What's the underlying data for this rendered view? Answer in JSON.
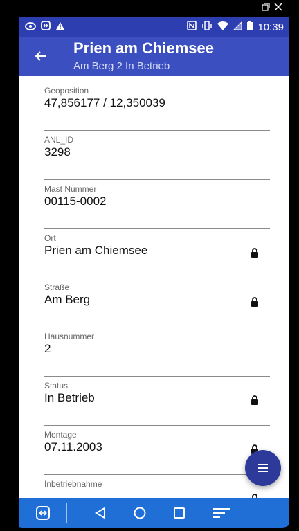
{
  "appbar": {
    "title": "Prien am Chiemsee",
    "subtitle": "Am Berg 2 In Betrieb"
  },
  "statusbar": {
    "time": "10:39",
    "icons_left": [
      "eye-icon",
      "teamviewer-icon",
      "warning-icon"
    ],
    "icons_right": [
      "nfc-icon",
      "vibrate-icon",
      "wifi-icon",
      "signal-icon",
      "battery-icon"
    ]
  },
  "window_controls": [
    "restore-icon",
    "close-icon"
  ],
  "fields": [
    {
      "label": "Geoposition",
      "value": "47,856177 / 12,350039",
      "locked": false
    },
    {
      "label": "ANL_ID",
      "value": "3298",
      "locked": false
    },
    {
      "label": "Mast Nummer",
      "value": "00115-0002",
      "locked": false
    },
    {
      "label": "Ort",
      "value": "Prien am Chiemsee",
      "locked": true
    },
    {
      "label": "Straße",
      "value": "Am Berg",
      "locked": true
    },
    {
      "label": "Hausnummer",
      "value": "2",
      "locked": false
    },
    {
      "label": "Status",
      "value": "In Betrieb",
      "locked": true
    },
    {
      "label": "Montage",
      "value": "07.11.2003",
      "locked": true
    },
    {
      "label": "Inbetriebnahme",
      "value": "",
      "locked": true
    }
  ],
  "navbar": {
    "icons": [
      "teamviewer-icon",
      "back-icon",
      "home-icon",
      "recents-icon",
      "menu-lines-icon"
    ]
  },
  "colors": {
    "appbar": "#3b4fc0",
    "statusbar": "#2d3fb0",
    "fab": "#2d3a9a",
    "navbar": "#1f6fd6"
  }
}
